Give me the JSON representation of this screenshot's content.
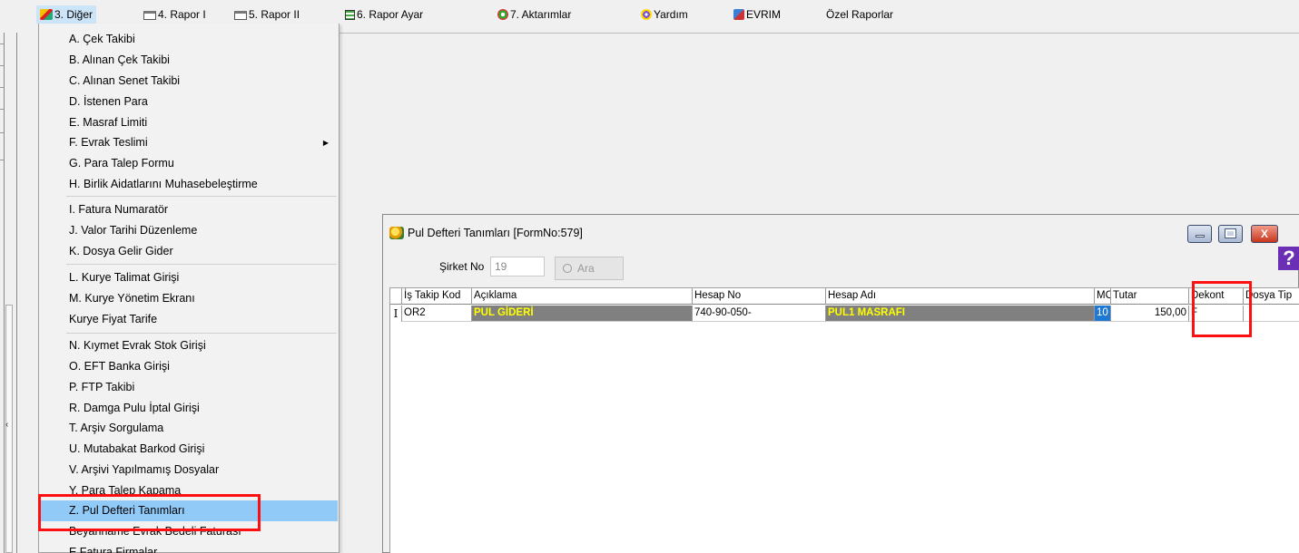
{
  "menubar": {
    "items": [
      {
        "label": "3. Diğer",
        "icon": "stack-icon"
      },
      {
        "label": "4. Rapor I",
        "icon": "printer-icon"
      },
      {
        "label": "5. Rapor II",
        "icon": "printer-icon"
      },
      {
        "label": "6. Rapor Ayar",
        "icon": "report-icon"
      },
      {
        "label": "7. Aktarımlar",
        "icon": "gears-icon"
      },
      {
        "label": "Yardım",
        "icon": "help-icon"
      },
      {
        "label": "EVRIM",
        "icon": "book-icon"
      },
      {
        "label": "Özel Raporlar"
      }
    ]
  },
  "dropdown": {
    "items": [
      {
        "label": "A.  Çek Takibi"
      },
      {
        "label": "B.  Alınan Çek Takibi"
      },
      {
        "label": "C.  Alınan Senet Takibi"
      },
      {
        "label": "D.  İstenen Para"
      },
      {
        "label": "E.  Masraf Limiti"
      },
      {
        "label": "F.  Evrak Teslimi",
        "submenu": true
      },
      {
        "label": "G.  Para Talep Formu"
      },
      {
        "label": "H.  Birlik Aidatlarını Muhasebeleştirme"
      },
      {
        "label": "I.  Fatura Numaratör"
      },
      {
        "label": "J.  Valor Tarihi Düzenleme"
      },
      {
        "label": "K.  Dosya Gelir Gider"
      },
      {
        "label": "L.   Kurye Talimat Girişi"
      },
      {
        "label": "M.  Kurye Yönetim Ekranı"
      },
      {
        "label": "Kurye Fiyat Tarife"
      },
      {
        "label": "N.  Kıymet Evrak Stok Girişi"
      },
      {
        "label": "O.  EFT Banka Girişi"
      },
      {
        "label": "P.  FTP Takibi"
      },
      {
        "label": "R.  Damga Pulu İptal  Girişi"
      },
      {
        "label": "T. Arşiv Sorgulama"
      },
      {
        "label": "U. Mutabakat Barkod Girişi"
      },
      {
        "label": "V. Arşivi Yapılmamış Dosyalar"
      },
      {
        "label": "Y.  Para Talep Kapama"
      },
      {
        "label": "Z. Pul Defteri Tanımları",
        "selected": true
      },
      {
        "label": "Beyanname Evrak Bedeli Faturası"
      },
      {
        "label": "E Fatura Firmalar"
      }
    ]
  },
  "window": {
    "title": "Pul Defteri Tanımları [FormNo:579]",
    "minimize": "minimize",
    "maximize": "maximize",
    "close": "X",
    "help": "?",
    "sirket_label": "Şirket No",
    "sirket_value": "19",
    "ara_label": "Ara",
    "columns": [
      "İş Takip Kod",
      "Açıklama",
      "Hesap No",
      "Hesap Adı",
      "MC",
      "Tutar",
      "Dekont",
      "Dosya Tip"
    ],
    "rows": [
      {
        "indicator": "I",
        "cells": [
          "OR2",
          "PUL GİDERİ",
          "740-90-050-",
          "PUL1 MASRAFI",
          "10",
          "150,00",
          "F",
          ""
        ]
      }
    ]
  },
  "colors": {
    "highlight_box": "#ff1010",
    "selected_menu": "#91c9f7",
    "dark_cell": "#808080",
    "yellow_text": "#ffff00",
    "mc_selected": "#1f78d1",
    "help_purple": "#6b2fb5"
  }
}
